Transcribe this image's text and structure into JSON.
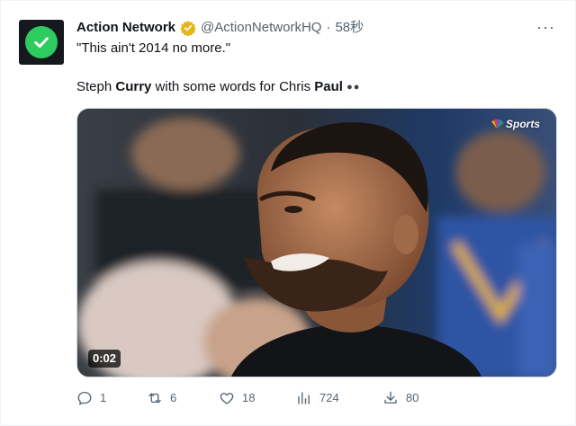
{
  "tweet": {
    "display_name": "Action Network",
    "handle": "@ActionNetworkHQ",
    "separator": "·",
    "time": "58秒",
    "more": "···",
    "quote_text": "\"This ain't 2014 no more.\"",
    "body": {
      "part1": "Steph ",
      "bold1": "Curry",
      "part2": " with some words for Chris ",
      "bold2": "Paul",
      "emoji": "●●"
    },
    "media": {
      "duration": "0:02",
      "watermark": "Sports"
    },
    "actions": {
      "replies": "1",
      "reposts": "6",
      "likes": "18",
      "views": "724",
      "bookmarks": "80"
    }
  },
  "colors": {
    "avatar_bg": "#15181c",
    "avatar_accent": "#2ecc5f",
    "verified_gold": "#e2b719",
    "secondary_text": "#536471"
  },
  "icons": [
    "check-icon",
    "verified-badge-icon",
    "more-icon",
    "reply-icon",
    "repost-icon",
    "like-icon",
    "views-icon",
    "share-icon"
  ]
}
